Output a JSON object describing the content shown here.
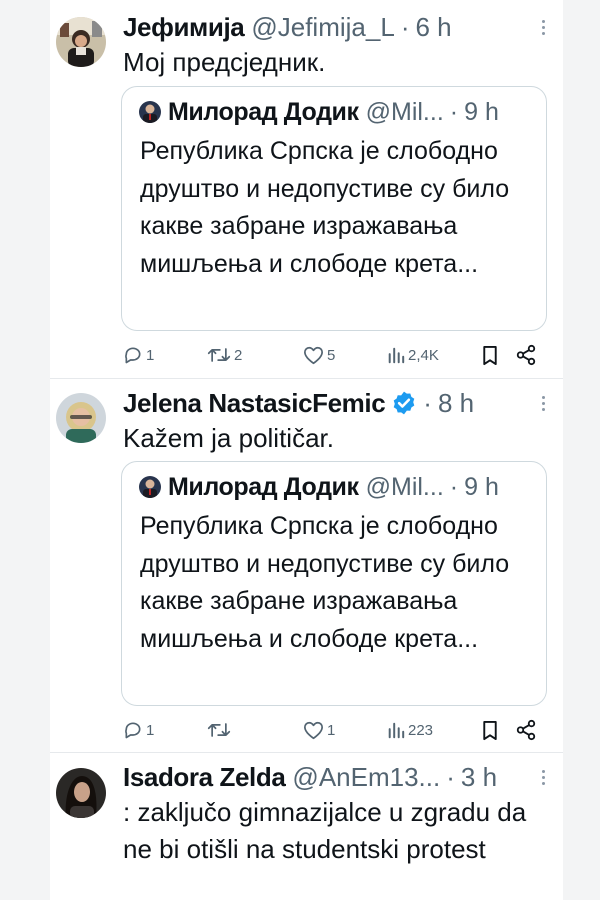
{
  "tweets": [
    {
      "author": "Јефимија",
      "handle": "@Jefimija_L",
      "time": "6 h",
      "text": "Мој предсједник.",
      "quote": {
        "author": "Милорад Додик",
        "handle": "@Mil...",
        "time": "9 h",
        "text": "Република Српска је слободно друштво и недопустиве су било какве забране изражавања мишљења и слободе крета..."
      },
      "replies": "1",
      "retweets": "2",
      "likes": "5",
      "views": "2,4K"
    },
    {
      "author": "Jelena NastasicFemic",
      "handle": "",
      "time": "8 h",
      "verified": true,
      "text": "Kažem ja političar.",
      "quote": {
        "author": "Милорад Додик",
        "handle": "@Mil...",
        "time": "9 h",
        "text": "Република Српска је слободно друштво и недопустиве су било какве забране изражавања мишљења и слободе крета..."
      },
      "replies": "1",
      "retweets": "",
      "likes": "1",
      "views": "223"
    },
    {
      "author": "Isadora Zelda",
      "handle": "@AnEm13...",
      "time": "3 h",
      "text": ": zaključo gimnazijalce u zgradu da ne bi otišli na studentski protest"
    }
  ],
  "icons": {
    "reply": "reply-icon",
    "retweet": "retweet-icon",
    "like": "heart-icon",
    "views": "views-icon",
    "bookmark": "bookmark-icon",
    "share": "share-icon",
    "more": "more-icon",
    "verified": "verified-badge-icon"
  },
  "colors": {
    "text": "#0f1419",
    "secondary": "#536471",
    "verified": "#1d9bf0",
    "border": "#cfd9de"
  }
}
